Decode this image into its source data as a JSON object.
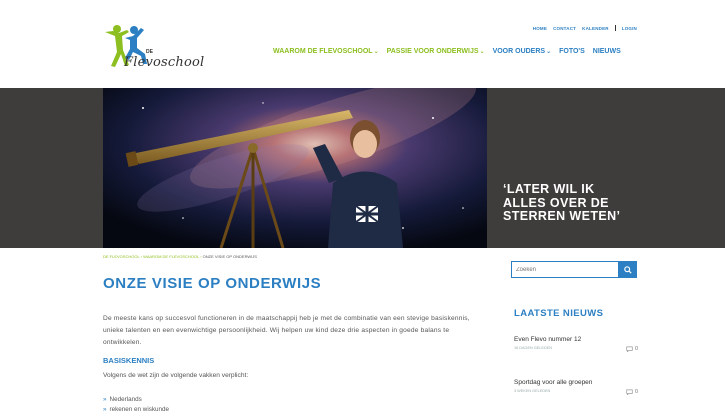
{
  "brand": {
    "prefix": "DE",
    "name": "Flevoschool",
    "colors": {
      "green": "#8cbf1f",
      "blue": "#2b7fc2",
      "dark": "#3f3d3b"
    }
  },
  "topnav": {
    "items": [
      "HOME",
      "CONTACT",
      "KALENDER"
    ],
    "login": "LOGIN"
  },
  "mainnav": {
    "items": [
      {
        "label": "WAAROM DE FLEVOSCHOOL",
        "has_dropdown": true
      },
      {
        "label": "PASSIE VOOR ONDERWIJS",
        "has_dropdown": true
      },
      {
        "label": "VOOR OUDERS",
        "has_dropdown": true
      },
      {
        "label": "FOTO'S",
        "has_dropdown": false
      },
      {
        "label": "NIEUWS",
        "has_dropdown": false
      }
    ]
  },
  "hero": {
    "quote": "‘LATER WIL IK ALLES OVER DE STERREN WETEN’"
  },
  "breadcrumb": {
    "items": [
      "DE FLEVOSCHOOL",
      "WAAROM DE FLEVOSCHOOL"
    ],
    "current": "ONZE VISIE OP ONDERWIJS",
    "separator": "›"
  },
  "main": {
    "title": "ONZE VISIE OP ONDERWIJS",
    "intro": "De meeste kans op succesvol functioneren in de maatschappij heb je met de combinatie van een stevige basiskennis, unieke talenten en een evenwichtige persoonlijkheid. Wij helpen uw kind deze drie aspecten in goede balans te ontwikkelen.",
    "section_heading": "BASISKENNIS",
    "section_text": "Volgens de wet zijn de volgende vakken verplicht:",
    "subjects": [
      "Nederlands",
      "rekenen en wiskunde"
    ]
  },
  "sidebar": {
    "search_placeholder": "Zoeken",
    "news_heading": "LAATSTE NIEUWS",
    "news": [
      {
        "title": "Even Flevo nummer 12",
        "date": "16 DAGEN GELEDEN",
        "comments": "0"
      },
      {
        "title": "Sportdag voor alle groepen",
        "date": "3 WEKEN GELEDEN",
        "comments": "0"
      }
    ]
  },
  "icons": [
    "logo-figures-icon",
    "chevron-down-icon",
    "search-icon",
    "comment-icon",
    "bullet-icon"
  ]
}
